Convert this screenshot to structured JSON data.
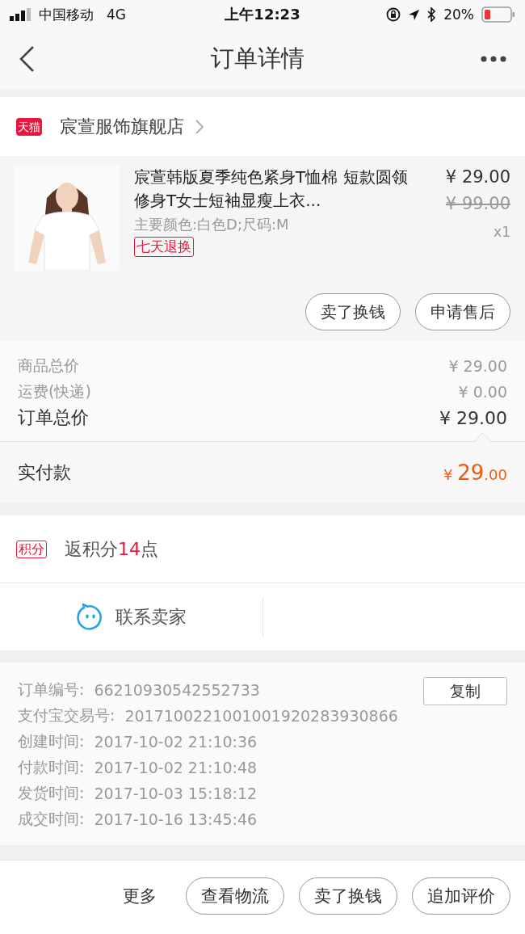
{
  "status_bar": {
    "carrier": "中国移动",
    "network": "4G",
    "time": "上午12:23",
    "battery": "20%"
  },
  "nav": {
    "title": "订单详情"
  },
  "shop": {
    "badge": "天猫",
    "name": "宸萱服饰旗舰店"
  },
  "product": {
    "kind": "picture",
    "title": "宸萱韩版夏季纯色紧身T恤棉 短款圆领修身T女士短袖显瘦上衣...",
    "sku": "主要颜色:白色D;尺码:M",
    "tag": "七天退换",
    "price": "¥ 29.00",
    "original_price": "¥ 99.00",
    "quantity": "x1",
    "actions": [
      "卖了换钱",
      "申请售后"
    ]
  },
  "summary": {
    "rows": [
      {
        "kind": "minor",
        "label": "商品总价",
        "value": "¥ 29.00"
      },
      {
        "kind": "minor",
        "label": "运费(快递)",
        "value": "¥ 0.00"
      },
      {
        "kind": "major",
        "label": "订单总价",
        "value": "¥ 29.00"
      }
    ],
    "paid": {
      "label": "实付款",
      "currency": "¥",
      "integer": "29",
      "decimal": ".00"
    }
  },
  "points": {
    "badge": "积分",
    "prefix": "返积分",
    "amount": "14",
    "suffix": "点"
  },
  "contact": {
    "label": "联系卖家"
  },
  "info": {
    "copy_button": "复制",
    "rows": [
      {
        "label": "订单编号:",
        "value": "66210930542552733"
      },
      {
        "label": "支付宝交易号:",
        "value": "2017100221001001920283930866"
      },
      {
        "label": "创建时间:",
        "value": "2017-10-02 21:10:36"
      },
      {
        "label": "付款时间:",
        "value": "2017-10-02 21:10:48"
      },
      {
        "label": "发货时间:",
        "value": "2017-10-03 15:18:12"
      },
      {
        "label": "成交时间:",
        "value": "2017-10-16 13:45:46"
      }
    ]
  },
  "bottom_bar": {
    "more": "更多",
    "buttons": [
      "查看物流",
      "卖了换钱",
      "追加评价"
    ]
  }
}
